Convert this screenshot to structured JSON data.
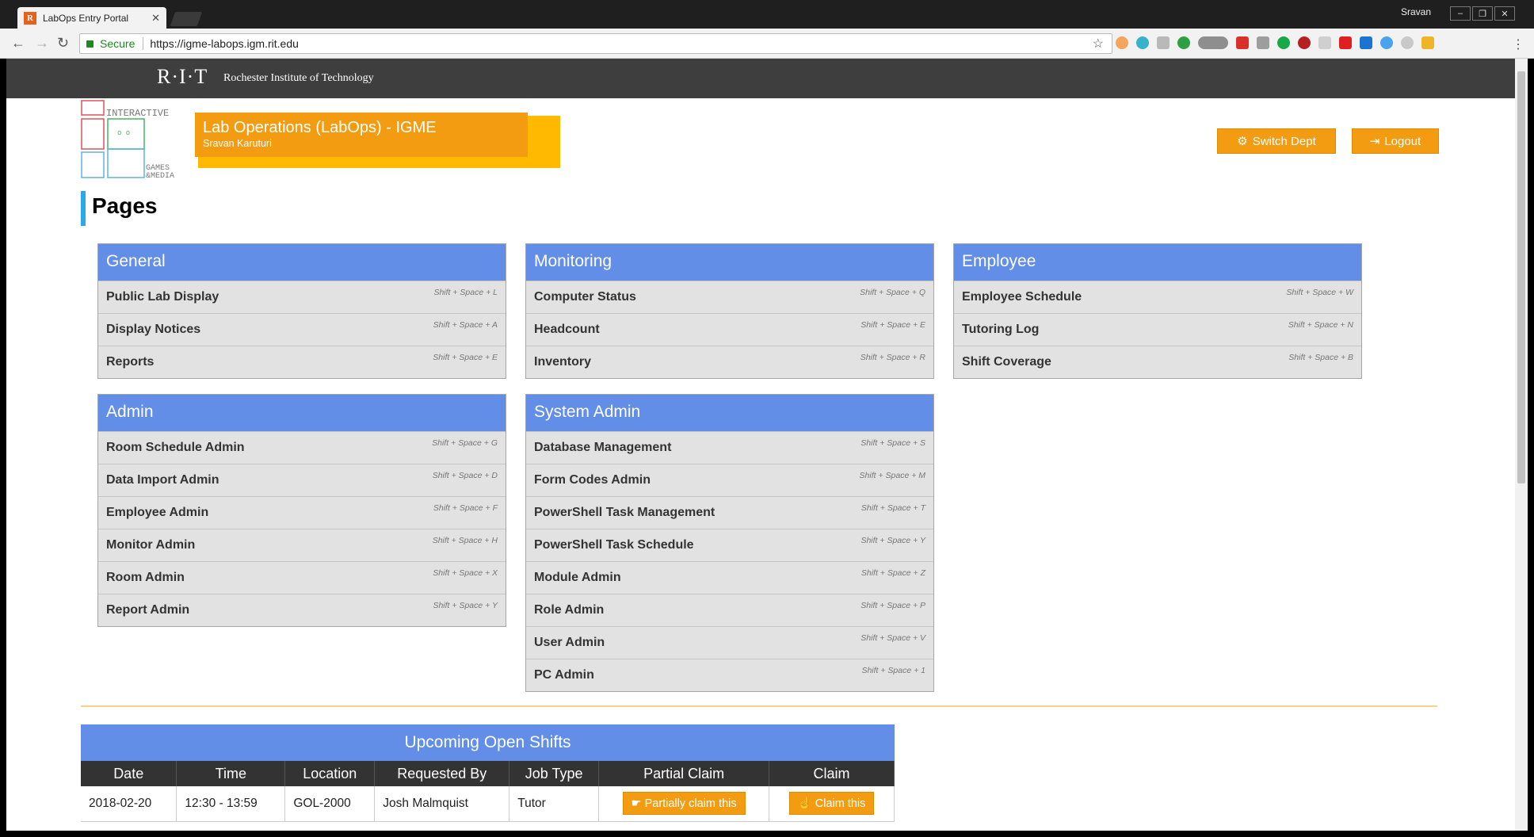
{
  "browser": {
    "tab_title": "LabOps Entry Portal",
    "tab_favicon": "R",
    "profile": "Sravan",
    "secure_label": "Secure",
    "url": "https://igme-labops.igm.rit.edu"
  },
  "rit": {
    "logo": "R·I·T",
    "name": "Rochester Institute of Technology"
  },
  "header": {
    "title": "Lab Operations (LabOps) - IGME",
    "user": "Sravan Karuturi",
    "brand_lines": [
      "INTERACTIVE",
      "GAMES",
      "&MEDIA"
    ]
  },
  "buttons": {
    "switch_dept": "Switch Dept",
    "logout": "Logout"
  },
  "pages_title": "Pages",
  "panels": {
    "general": {
      "title": "General",
      "items": [
        {
          "label": "Public Lab Display",
          "shortcut": "Shift + Space + L"
        },
        {
          "label": "Display Notices",
          "shortcut": "Shift + Space + A"
        },
        {
          "label": "Reports",
          "shortcut": "Shift + Space + E"
        }
      ]
    },
    "monitoring": {
      "title": "Monitoring",
      "items": [
        {
          "label": "Computer Status",
          "shortcut": "Shift + Space + Q"
        },
        {
          "label": "Headcount",
          "shortcut": "Shift + Space + E"
        },
        {
          "label": "Inventory",
          "shortcut": "Shift + Space + R"
        }
      ]
    },
    "employee": {
      "title": "Employee",
      "items": [
        {
          "label": "Employee Schedule",
          "shortcut": "Shift + Space + W"
        },
        {
          "label": "Tutoring Log",
          "shortcut": "Shift + Space + N"
        },
        {
          "label": "Shift Coverage",
          "shortcut": "Shift + Space + B"
        }
      ]
    },
    "admin": {
      "title": "Admin",
      "items": [
        {
          "label": "Room Schedule Admin",
          "shortcut": "Shift + Space + G"
        },
        {
          "label": "Data Import Admin",
          "shortcut": "Shift + Space + D"
        },
        {
          "label": "Employee Admin",
          "shortcut": "Shift + Space + F"
        },
        {
          "label": "Monitor Admin",
          "shortcut": "Shift + Space + H"
        },
        {
          "label": "Room Admin",
          "shortcut": "Shift + Space + X"
        },
        {
          "label": "Report Admin",
          "shortcut": "Shift + Space + Y"
        }
      ]
    },
    "system_admin": {
      "title": "System Admin",
      "items": [
        {
          "label": "Database Management",
          "shortcut": "Shift + Space + S"
        },
        {
          "label": "Form Codes Admin",
          "shortcut": "Shift + Space + M"
        },
        {
          "label": "PowerShell Task Management",
          "shortcut": "Shift + Space + T"
        },
        {
          "label": "PowerShell Task Schedule",
          "shortcut": "Shift + Space + Y"
        },
        {
          "label": "Module Admin",
          "shortcut": "Shift + Space + Z"
        },
        {
          "label": "Role Admin",
          "shortcut": "Shift + Space + P"
        },
        {
          "label": "User Admin",
          "shortcut": "Shift + Space + V"
        },
        {
          "label": "PC Admin",
          "shortcut": "Shift + Space + 1"
        }
      ]
    }
  },
  "shifts": {
    "title": "Upcoming Open Shifts",
    "columns": [
      "Date",
      "Time",
      "Location",
      "Requested By",
      "Job Type",
      "Partial Claim",
      "Claim"
    ],
    "rows": [
      {
        "date": "2018-02-20",
        "time": "12:30 - 13:59",
        "location": "GOL-2000",
        "requested_by": "Josh Malmquist",
        "job_type": "Tutor",
        "partial_label": "Partially claim this",
        "claim_label": "Claim this"
      }
    ]
  },
  "colors": {
    "accent": "#f39c12",
    "panel_header": "#628ee8",
    "rit_bar": "#3e3e3e"
  }
}
